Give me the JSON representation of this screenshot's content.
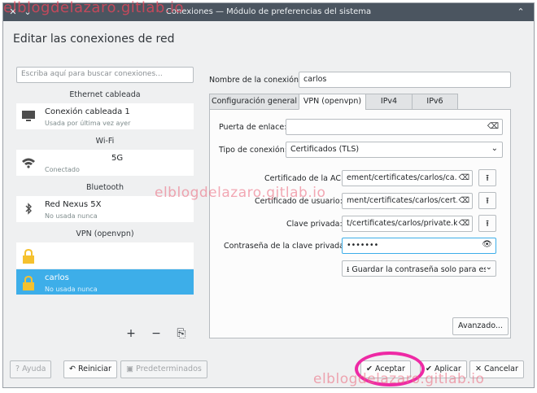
{
  "window": {
    "title": "Conexiones — Módulo de preferencias del sistema"
  },
  "watermark": "elblogdelazaro.gitlab.io",
  "heading": "Editar las conexiones de red",
  "search": {
    "placeholder": "Escriba aquí para buscar conexiones..."
  },
  "sections": {
    "ethernet": "Ethernet cableada",
    "wifi": "Wi-Fi",
    "bluetooth": "Bluetooth",
    "vpn": "VPN (openvpn)"
  },
  "connections": {
    "wired": {
      "name": "Conexión cableada 1",
      "status": "Usada por última vez ayer"
    },
    "wifi": {
      "name": "5G",
      "status": "Conectado"
    },
    "bluetooth": {
      "name": "Red Nexus 5X",
      "status": "No usada nunca"
    },
    "vpn1": {
      "name": "",
      "status": ""
    },
    "vpn2": {
      "name": "carlos",
      "status": "No usada nunca"
    }
  },
  "left_tools": {
    "add": "+",
    "remove": "−",
    "export": "⎘"
  },
  "form": {
    "name_label": "Nombre de la conexión:",
    "name_value": "carlos"
  },
  "tabs": [
    "Configuración general",
    "VPN (openvpn)",
    "IPv4",
    "IPv6"
  ],
  "vpn": {
    "gateway_label": "Puerta de enlace:",
    "gateway_value": "",
    "conntype_label": "Tipo de conexión:",
    "conntype_value": "Certificados (TLS)",
    "ca_label": "Certificado de la AC:",
    "ca_value": "ement/certificates/carlos/ca.crt",
    "user_label": "Certificado de usuario:",
    "user_value": "ment/certificates/carlos/cert.crt",
    "key_label": "Clave privada:",
    "key_value": "t/certificates/carlos/private.key",
    "pass_label": "Contraseña de la clave privada:",
    "pass_value": "•••••••",
    "store_value": "Guardar la contraseña solo para est",
    "advanced": "Avanzado..."
  },
  "buttons": {
    "help": "Ayuda",
    "reset": "Reiniciar",
    "defaults": "Predeterminados",
    "ok": "Aceptar",
    "apply": "Aplicar",
    "cancel": "Cancelar"
  },
  "colors": {
    "selection": "#3daee9",
    "titlebar": "#4b5560",
    "highlight_circle": "#ee2aa5"
  }
}
